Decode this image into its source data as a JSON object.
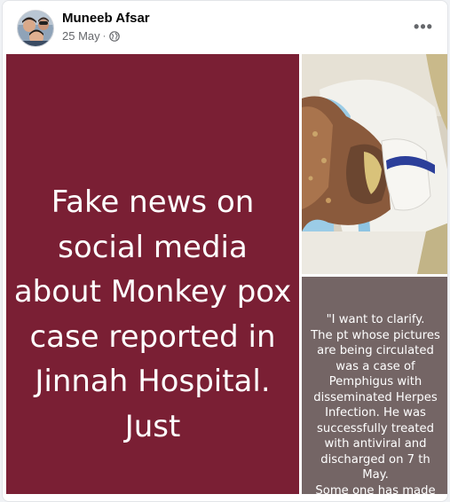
{
  "post": {
    "author": "Muneeb Afsar",
    "date": "25 May",
    "separator": "·",
    "privacy_icon": "globe-icon",
    "more_icon": "more-options-icon",
    "more_label": "•••"
  },
  "media": {
    "left_text": "Fake news on social media about Monkey pox case reported in Jinnah Hospital. Just",
    "right_text": "\"I want to clarify.\nThe pt whose pictures are being circulated was a case of Pemphigus with disseminated Herpes Infection. He was successfully treated with antiviral and discharged on 7 th May.\nSome one has made",
    "colors": {
      "left_bg": "#7a1f34",
      "right_bg": "#746565"
    }
  }
}
